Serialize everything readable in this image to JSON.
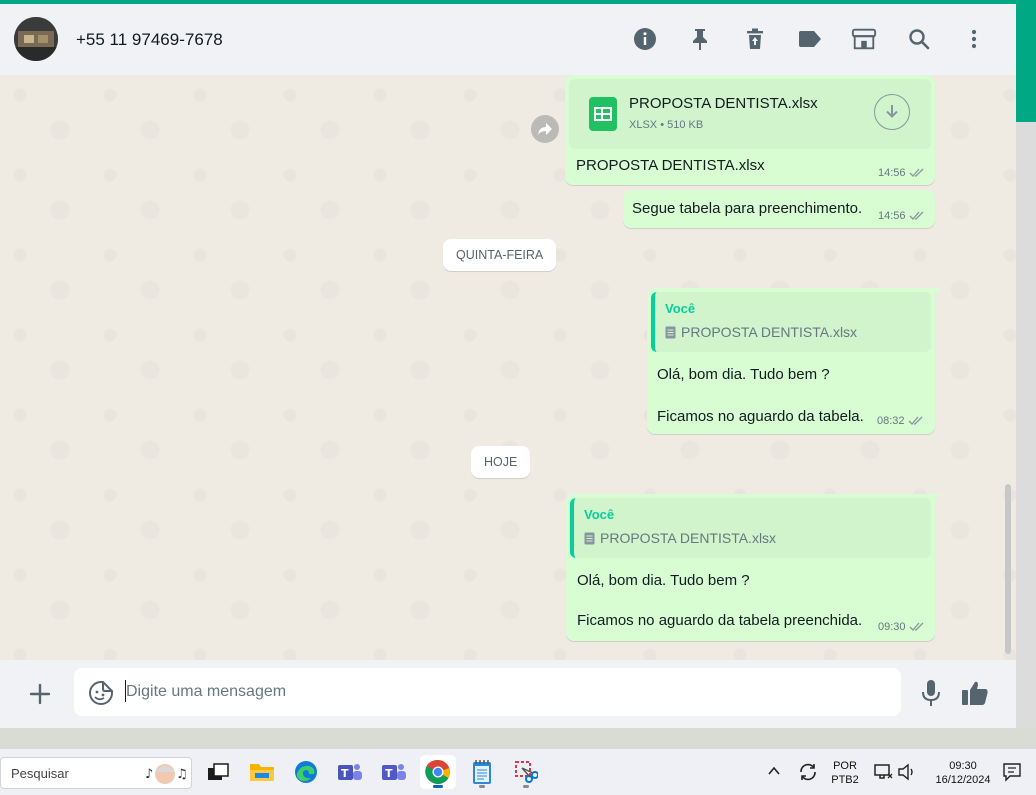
{
  "header": {
    "contact_name": "+55 11 97469-7678"
  },
  "messages": {
    "file_name": "PROPOSTA DENTISTA.xlsx",
    "file_type": "XLSX",
    "file_size": "510 KB",
    "file_caption": "PROPOSTA DENTISTA.xlsx",
    "file_time": "14:56",
    "msg2_text": "Segue tabela para preenchimento.",
    "msg2_time": "14:56",
    "date_thursday": "QUINTA-FEIRA",
    "reply1_author": "Você",
    "reply1_quoted": "PROPOSTA DENTISTA.xlsx",
    "reply1_line1": "Olá, bom dia. Tudo bem ?",
    "reply1_line2": "Ficamos no aguardo da tabela.",
    "reply1_time": "08:32",
    "date_today": "HOJE",
    "reply2_author": "Você",
    "reply2_quoted": "PROPOSTA DENTISTA.xlsx",
    "reply2_line1": "Olá, bom dia. Tudo bem ?",
    "reply2_line2": "Ficamos no aguardo da tabela preenchida.",
    "reply2_time": "09:30"
  },
  "composer": {
    "placeholder": "Digite uma mensagem"
  },
  "taskbar": {
    "search_placeholder": "Pesquisar",
    "lang_line1": "POR",
    "lang_line2": "PTB2",
    "clock_time": "09:30",
    "clock_date": "16/12/2024"
  },
  "colors": {
    "accent": "#00a884",
    "outgoing_bubble": "#d9fdd3",
    "quote_bar": "#06cf9c",
    "chat_bg": "#efeae2"
  }
}
